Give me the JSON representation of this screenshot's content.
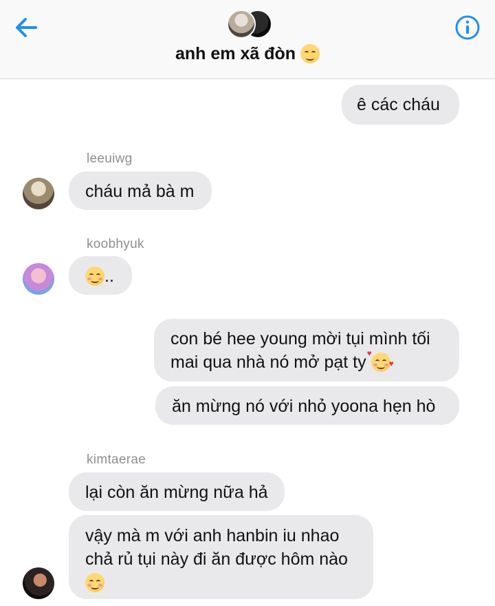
{
  "header": {
    "back_icon": "back-arrow-icon",
    "info_icon": "info-icon",
    "title": "anh em xã đòn",
    "title_emoji": "smirk-face-emoji",
    "accent_color": "#1d8ff2"
  },
  "messages": [
    {
      "side": "right",
      "text": "ê các cháu"
    },
    {
      "side": "left",
      "sender": "leeuiwg",
      "text": "cháu mả bà m"
    },
    {
      "side": "left",
      "sender": "koobhyuk",
      "text": "..",
      "emoji": "smiling-face-emoji"
    },
    {
      "side": "right",
      "text_line1": "con bé hee young mời tụi mình tối",
      "text_line2": "mai qua nhà nó mở pạt ty",
      "emoji": "smiling-face-with-hearts-emoji"
    },
    {
      "side": "right",
      "text": "ăn mừng nó với nhỏ yoona hẹn hò"
    },
    {
      "side": "left",
      "sender": "kimtaerae",
      "text": "lại còn ăn mừng nữa hả"
    },
    {
      "side": "left",
      "text_line1": "vậy mà m với anh hanbin iu nhao",
      "text_line2": "chả rủ tụi này đi ăn được hôm nào",
      "emoji": "smiling-face-emoji"
    }
  ]
}
